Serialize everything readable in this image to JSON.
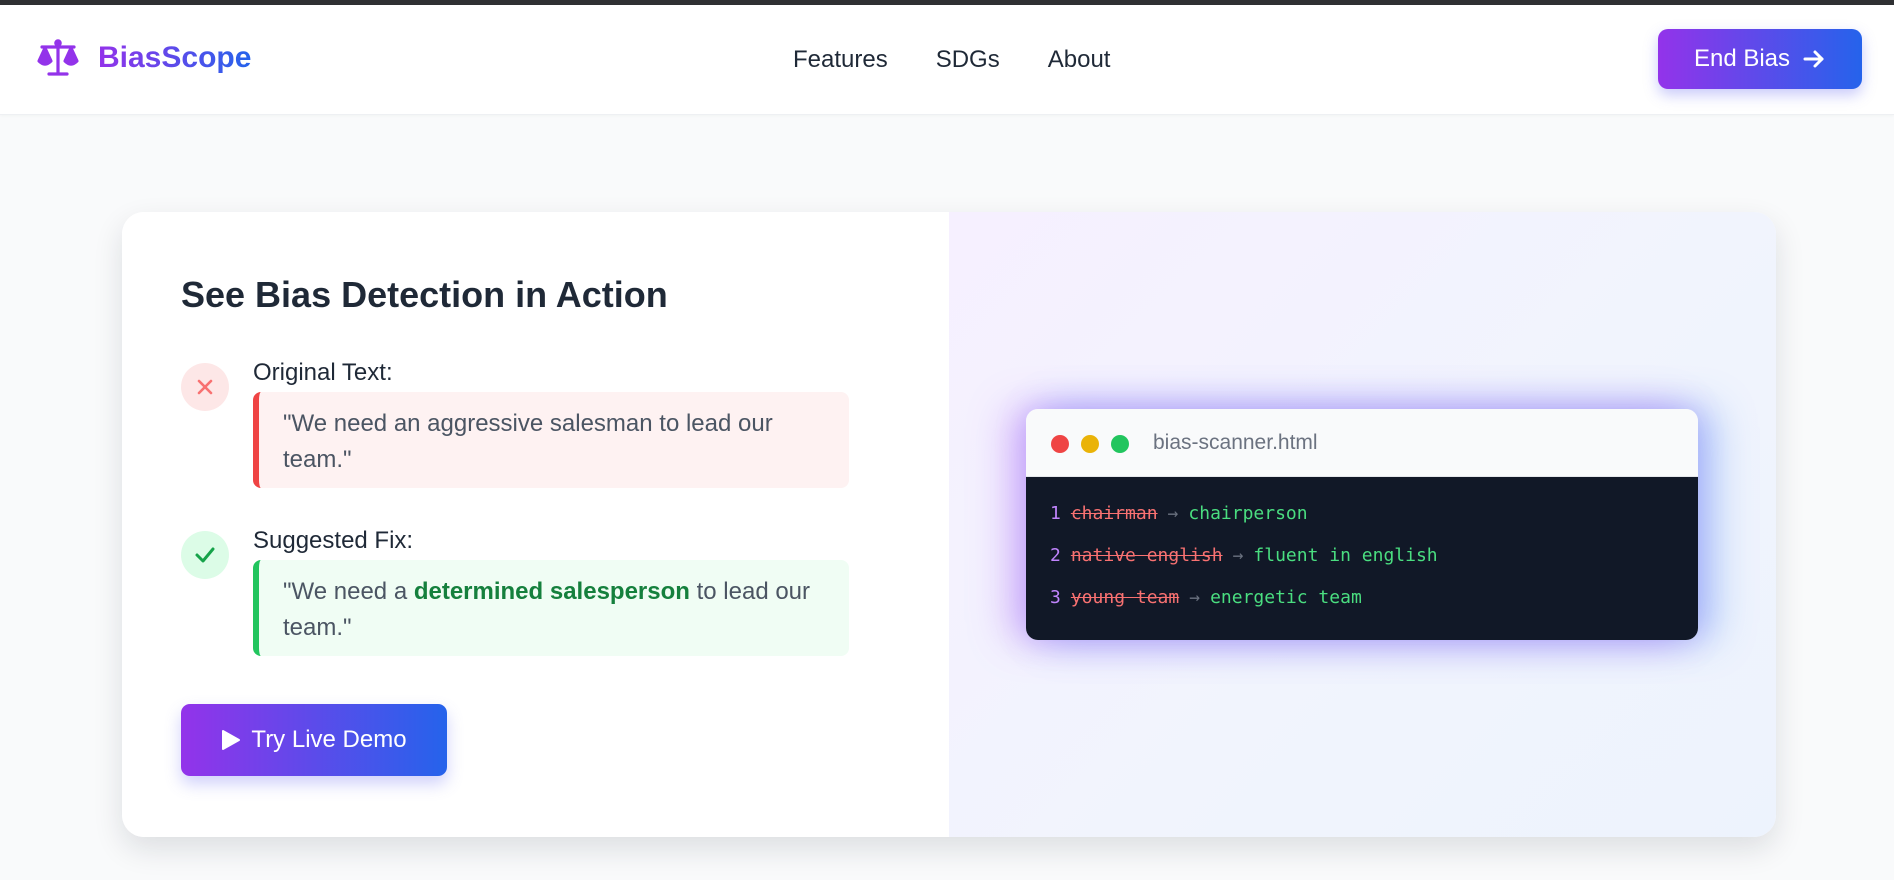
{
  "brand": {
    "name": "BiasScope",
    "logo_icon": "scale-icon",
    "color_start": "#9333ea",
    "color_end": "#2563eb"
  },
  "nav": {
    "links": [
      {
        "label": "Features"
      },
      {
        "label": "SDGs"
      },
      {
        "label": "About"
      }
    ]
  },
  "header_cta": {
    "label": "End Bias",
    "icon": "arrow-right-icon"
  },
  "demo": {
    "title": "See Bias Detection in Action",
    "original": {
      "label": "Original Text:",
      "text": "\"We need an aggressive salesman to lead our team.\"",
      "icon": "x-icon",
      "accent": "#ef4444"
    },
    "suggested": {
      "label": "Suggested Fix:",
      "text_before": "\"We need a ",
      "highlight": "determined salesperson",
      "text_after": " to lead our team.\"",
      "icon": "check-icon",
      "accent": "#22c55e"
    },
    "button": {
      "label": "Try Live Demo",
      "icon": "play-icon"
    }
  },
  "code_window": {
    "filename": "bias-scanner.html",
    "lines": [
      {
        "num": "1",
        "old": "chairman",
        "arrow": "→",
        "new": "chairperson"
      },
      {
        "num": "2",
        "old": "native english",
        "arrow": "→",
        "new": "fluent in english"
      },
      {
        "num": "3",
        "old": "young team",
        "arrow": "→",
        "new": "energetic team"
      }
    ]
  }
}
